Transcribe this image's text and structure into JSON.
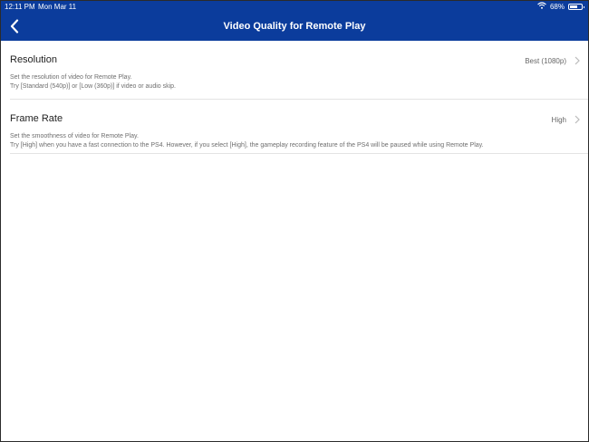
{
  "status_bar": {
    "time": "12:11 PM",
    "date": "Mon Mar 11",
    "battery_percent": "68%",
    "battery_level": 0.68,
    "wifi_icon": "wifi-icon"
  },
  "header": {
    "title": "Video Quality for Remote Play",
    "back_icon": "chevron-left-icon",
    "background_color": "#0b3c9c"
  },
  "settings": [
    {
      "label": "Resolution",
      "value": "Best (1080p)",
      "description": [
        "Set the resolution of video for Remote Play.",
        "Try [Standard (540p)] or [Low (360p)] if video or audio skip."
      ]
    },
    {
      "label": "Frame Rate",
      "value": "High",
      "description": [
        "Set the smoothness of video for Remote Play.",
        "Try [High] when you have a fast connection to the PS4. However, if you select [High], the gameplay recording feature of the PS4 will be paused while using Remote Play."
      ]
    }
  ]
}
